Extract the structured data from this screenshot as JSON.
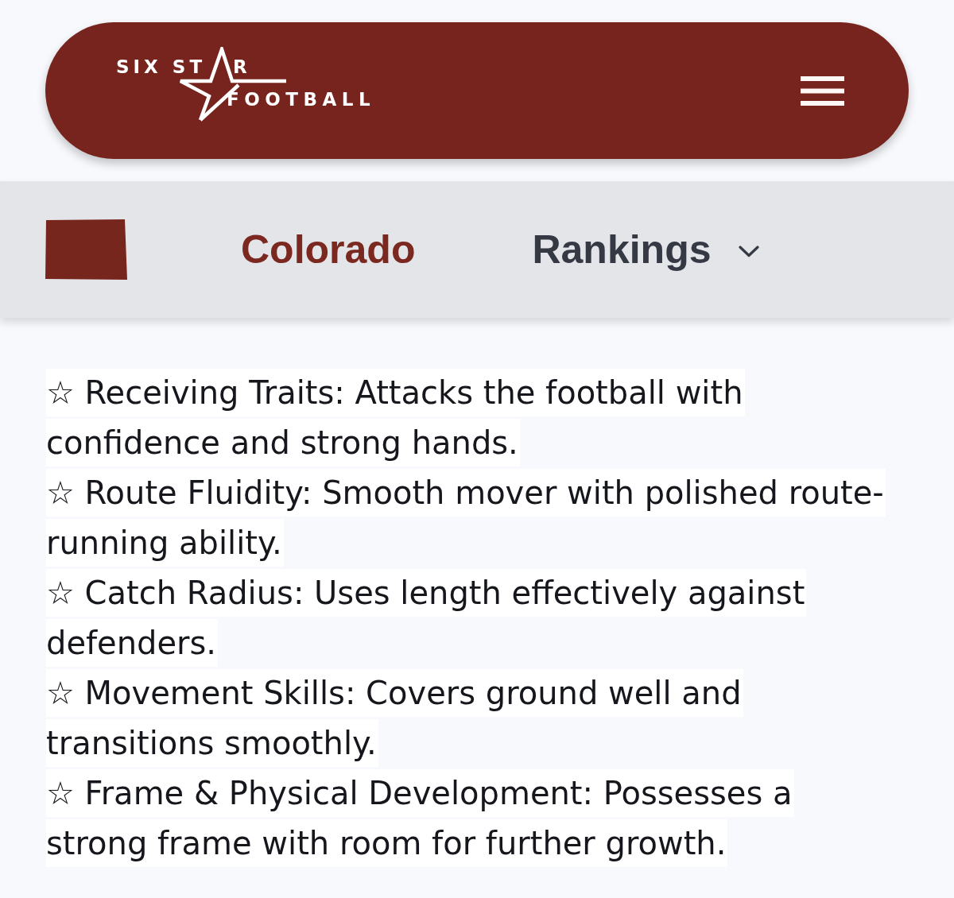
{
  "header": {
    "logo": {
      "text_left": "SIX ST",
      "text_right": "R",
      "text_bottom": "FOOTBALL"
    }
  },
  "nav": {
    "state": "Colorado",
    "menu": "Rankings"
  },
  "traits": [
    "☆ Receiving Traits: Attacks the football with confidence and strong hands.",
    "☆ Route Fluidity: Smooth mover with polished route-running ability.",
    "☆ Catch Radius: Uses length effectively against defenders.",
    "☆ Movement Skills: Covers ground well and transitions smoothly.",
    "☆ Frame & Physical Development: Possesses a strong frame with room for further growth."
  ]
}
